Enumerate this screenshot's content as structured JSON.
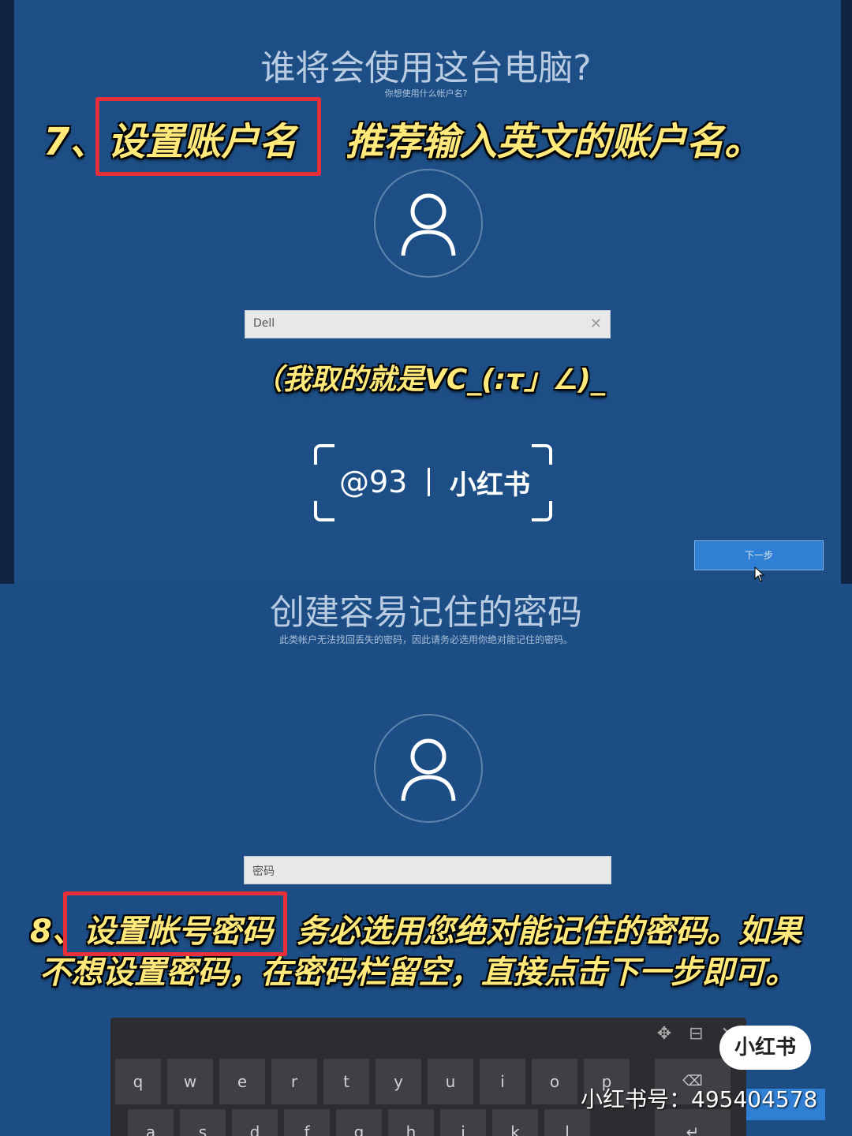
{
  "screen1": {
    "title": "谁将会使用这台电脑?",
    "subtitle": "你想使用什么帐户名?",
    "username_value": "Dell",
    "next_button": "下一步"
  },
  "screen2": {
    "title": "创建容易记住的密码",
    "subtitle": "此类帐户无法找回丢失的密码，因此请务必选用你绝对能记住的密码。",
    "password_placeholder": "密码"
  },
  "overlay": {
    "step7_prefix": "7、",
    "step7_highlight": "设置账户名",
    "step7_rest": "推荐输入英文的账户名。",
    "note": "（我取的就是VC_(:τ」∠)_",
    "step8_prefix": "8、",
    "step8_highlight": "设置帐号密码",
    "step8_rest": "务必选用您绝对能记住的密码。如果",
    "step8_line2": "不想设置密码，在密码栏留空，直接点击下一步即可。"
  },
  "watermark": {
    "handle": "@93",
    "brand": "小红书"
  },
  "badge": {
    "brand": "小红书",
    "id_text": "小红书号：495404578"
  },
  "keyboard": {
    "row1": [
      "q",
      "w",
      "e",
      "r",
      "t",
      "y",
      "u",
      "i",
      "o",
      "p"
    ],
    "row2": [
      "a",
      "s",
      "d",
      "f",
      "g",
      "h",
      "j",
      "k",
      "l"
    ]
  },
  "colors": {
    "background": "#1d4f86",
    "highlight_border": "#e8303a",
    "overlay_text": "#ffe97a"
  }
}
